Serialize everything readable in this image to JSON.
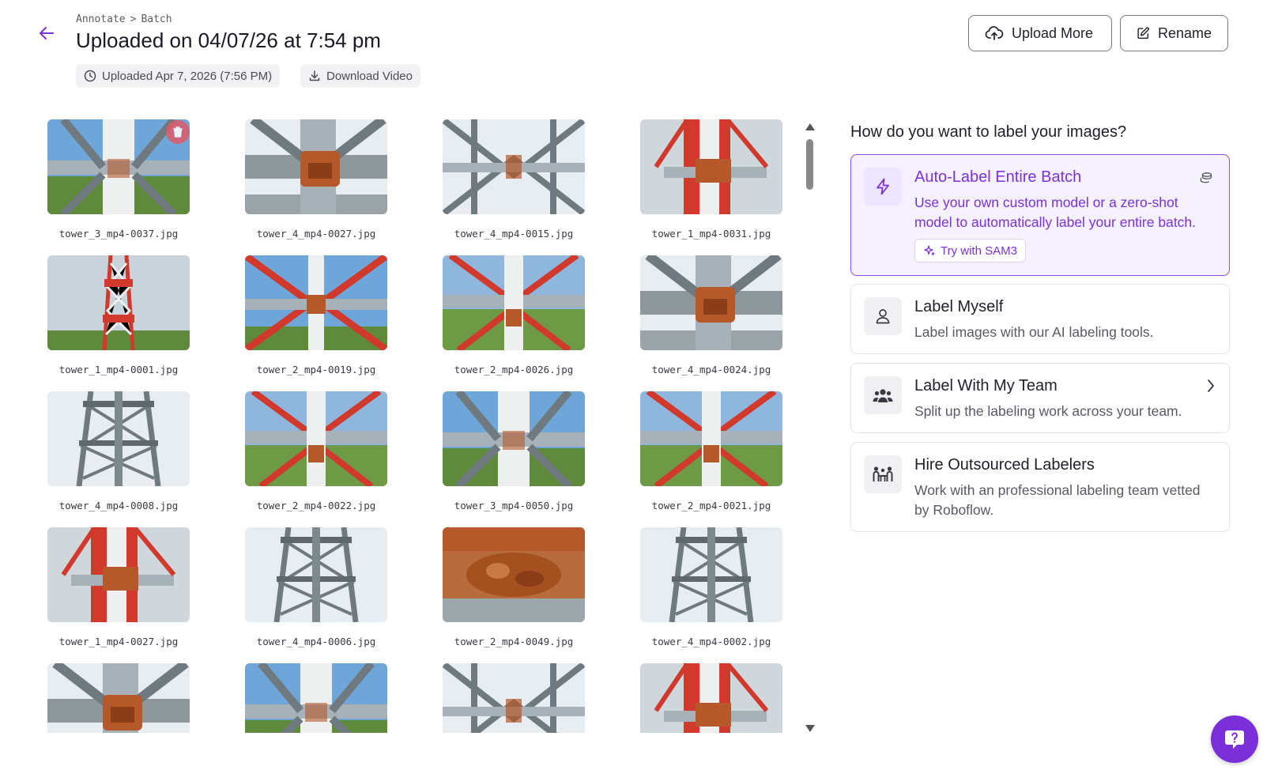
{
  "breadcrumb": {
    "item1": "Annotate",
    "separator": ">",
    "item2": "Batch"
  },
  "title": "Uploaded on 04/07/26 at 7:54 pm",
  "meta": {
    "uploaded": "Uploaded Apr 7, 2026 (7:56 PM)",
    "download": "Download Video"
  },
  "buttons": {
    "upload": "Upload More",
    "rename": "Rename"
  },
  "images": [
    {
      "name": "tower_3_mp4-0037.jpg",
      "theme": "closeup-grey-sky"
    },
    {
      "name": "tower_4_mp4-0027.jpg",
      "theme": "rust-grey"
    },
    {
      "name": "tower_4_mp4-0015.jpg",
      "theme": "lattice-grey"
    },
    {
      "name": "tower_1_mp4-0031.jpg",
      "theme": "red-rust"
    },
    {
      "name": "tower_1_mp4-0001.jpg",
      "theme": "redwhite-tower"
    },
    {
      "name": "tower_2_mp4-0019.jpg",
      "theme": "red-lattice"
    },
    {
      "name": "tower_2_mp4-0026.jpg",
      "theme": "red-lattice-field"
    },
    {
      "name": "tower_4_mp4-0024.jpg",
      "theme": "rust-grey"
    },
    {
      "name": "tower_4_mp4-0008.jpg",
      "theme": "grey-tower"
    },
    {
      "name": "tower_2_mp4-0022.jpg",
      "theme": "red-lattice-field"
    },
    {
      "name": "tower_3_mp4-0050.jpg",
      "theme": "closeup-grey-sky"
    },
    {
      "name": "tower_2_mp4-0021.jpg",
      "theme": "red-lattice-field"
    },
    {
      "name": "tower_1_mp4-0027.jpg",
      "theme": "red-rust"
    },
    {
      "name": "tower_4_mp4-0006.jpg",
      "theme": "grey-tower"
    },
    {
      "name": "tower_2_mp4-0049.jpg",
      "theme": "heavy-rust"
    },
    {
      "name": "tower_4_mp4-0002.jpg",
      "theme": "grey-tower"
    },
    {
      "name": "",
      "theme": "rust-grey"
    },
    {
      "name": "",
      "theme": "closeup-grey-sky"
    },
    {
      "name": "",
      "theme": "lattice-grey"
    },
    {
      "name": "",
      "theme": "red-rust"
    }
  ],
  "panel": {
    "question": "How do you want to label your images?",
    "auto": {
      "title": "Auto-Label Entire Batch",
      "desc": "Use your own custom model or a zero-shot model to automatically label your entire batch.",
      "cta": "Try with SAM3"
    },
    "myself": {
      "title": "Label Myself",
      "desc": "Label images with our AI labeling tools."
    },
    "team": {
      "title": "Label With My Team",
      "desc": "Split up the labeling work across your team."
    },
    "hire": {
      "title": "Hire Outsourced Labelers",
      "desc": "Work with an professional labeling team vetted by Roboflow."
    }
  },
  "colors": {
    "accent": "#7b32d6",
    "accent_bg": "#f6f1ff",
    "rust": "#b5582a",
    "tower_red": "#d0392b",
    "steel": "#9aa6ad"
  }
}
